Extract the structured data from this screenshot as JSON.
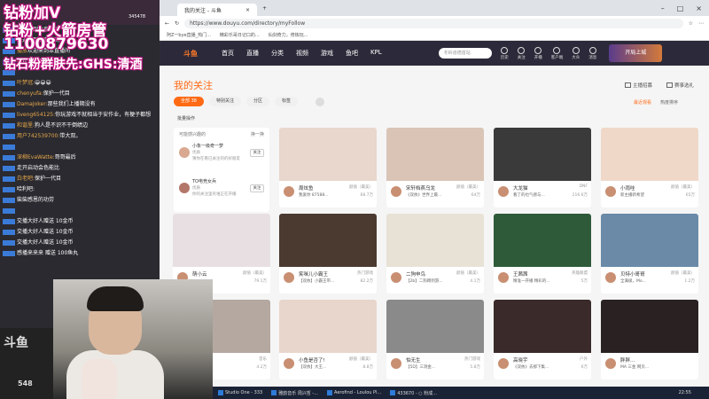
{
  "overlay": {
    "line1": "钻粉加V",
    "line2": "钻粉+火箭房管",
    "line3": "1100879630",
    "line4": "钻石粉群肤先:GHS:清酒",
    "counter": "345478"
  },
  "chat": {
    "messages": [
      {
        "user": "",
        "text": "欢迎来到本直播间"
      },
      {
        "user": "",
        "text": "欢迎来到本直播间"
      },
      {
        "user": "播放",
        "text": "欢迎来到本直播间"
      },
      {
        "user": "凯",
        "text": "欢迎来到本直播间"
      },
      {
        "user": "",
        "text": ""
      },
      {
        "user": "叶梦冠:",
        "text": "😀😀😀"
      },
      {
        "user": "chenyufa:",
        "text": "保护一代目"
      },
      {
        "user": "DamaJoker:",
        "text": "那些我们上播期没有"
      },
      {
        "user": "liveng654125:",
        "text": "你玩游戏不就相当于安作业，有梗子都想"
      },
      {
        "user": "和谐里:",
        "text": "狗人是不识不干倒绩边"
      },
      {
        "user": "用户742539700:",
        "text": "带大双。"
      },
      {
        "user": "",
        "text": ""
      },
      {
        "user": "深柳EvaWatte:",
        "text": "哥哥最后"
      },
      {
        "user": "",
        "text": "走开启动会色能比"
      },
      {
        "user": "白老吧:",
        "text": "保护一代目"
      },
      {
        "user": "",
        "text": "哈利吧:"
      },
      {
        "user": "",
        "text": "柴柴感恩的功劳"
      },
      {
        "user": "",
        "text": ""
      },
      {
        "user": "",
        "text": "交播大好人赠送 10金币"
      },
      {
        "user": "",
        "text": "交播大好人赠送 10金币"
      },
      {
        "user": "",
        "text": "交播大好人赠送 10金币"
      },
      {
        "user": "",
        "text": "感播来来来 赠送 100鱼丸"
      }
    ]
  },
  "cam": {
    "brand": "斗鱼",
    "num": "548"
  },
  "browser": {
    "tab_title": "我的关注 - 斗鱼",
    "url": "https://www.douyu.com/directory/myFollow",
    "bookmarks": [
      "阿Z一bye直播_热门...",
      "精彩乐哥日记口的...",
      "仙剑奇力，修炼玩..."
    ],
    "brand": "斗鱼",
    "nav": [
      "首页",
      "直播",
      "分类",
      "视频",
      "游戏",
      "鱼吧",
      "KPL"
    ],
    "search_placeholder": "冬岭道德首站",
    "nav_icons": [
      "历史",
      "关注",
      "开播",
      "客户端",
      "大众",
      "消息"
    ],
    "promo": "开局上城"
  },
  "page": {
    "title": "我的关注",
    "top_links": [
      "主播招募",
      "赛事选礼"
    ],
    "filters": [
      "全部 38",
      "特别关注",
      "分区",
      "标签"
    ],
    "right_links": [
      "最近观看",
      "热度排序"
    ],
    "batch": "批量操作",
    "recommend": {
      "title": "可能感兴趣的",
      "refresh": "换一换",
      "items": [
        {
          "name": "小象一级奇一梦",
          "sub": "优质",
          "desc": "猜你在看已关注的的好朋友"
        },
        {
          "name": "TO电竞女兵",
          "sub": "优质",
          "desc": "你的关注里有谁正在开播"
        }
      ],
      "follow": "关注"
    },
    "cards": [
      {
        "name": "周炫鱼",
        "title": "我爱你 87588...",
        "cat": "颜值（最美）",
        "hot": "68.7万"
      },
      {
        "name": "宋轩档燕乌龙",
        "title": "《双依》世界上最...",
        "cat": "颜值（最美）",
        "hot": "64万"
      },
      {
        "name": "大龙猫",
        "title": "看了的也气感与...",
        "cat": "DNF",
        "hot": "216.6万"
      },
      {
        "name": "小雨哇",
        "title": "新主播新希望",
        "cat": "颜值（最美）",
        "hot": "65万"
      },
      {
        "name": "萌小云",
        "title": "",
        "cat": "颜值（最美）",
        "hot": "79.1万"
      },
      {
        "name": "笑咪儿小霸王",
        "title": "【双依】小霸王带...",
        "cat": "热门游戏",
        "hot": "82.2万"
      },
      {
        "name": "二狗申鸟",
        "title": "【2b】二狗蹲到游...",
        "cat": "颜值（最美）",
        "hot": "4.1万"
      },
      {
        "name": "王茜茜",
        "title": "精准一开播 精彩的...",
        "cat": "英雄联盟",
        "hot": "5万"
      },
      {
        "name": "贝特小哥哥",
        "title": "全满级，Mo...",
        "cat": "颜值（最美）",
        "hot": "1.2万"
      },
      {
        "name": "大大神",
        "title": "",
        "cat": "音乐",
        "hot": "4.2万"
      },
      {
        "name": "小鱼是否了!",
        "title": "【双依】大王...",
        "cat": "颜值（最美）",
        "hot": "8.8万"
      },
      {
        "name": "怕无生",
        "title": "【5D】三洞金...",
        "cat": "热门游戏",
        "hot": "5.8万"
      },
      {
        "name": "高晓宇",
        "title": "《双依》去那下集...",
        "cat": "户外",
        "hot": "6万"
      },
      {
        "name": "胖胖...",
        "title": "MA 三金 网页...",
        "cat": "",
        "hot": ""
      }
    ]
  },
  "taskbar": {
    "items": [
      "Studio One - 333",
      "雅韵音乐 周兴哲 -...",
      "Aerofind - Loulou Pl...",
      "433670 - ○ 粉成..."
    ],
    "time": "22:55"
  },
  "colors": {
    "accent": "#ff6a14",
    "nav_bg": "#2c2a3a",
    "overlay_stroke": "#c41080"
  }
}
